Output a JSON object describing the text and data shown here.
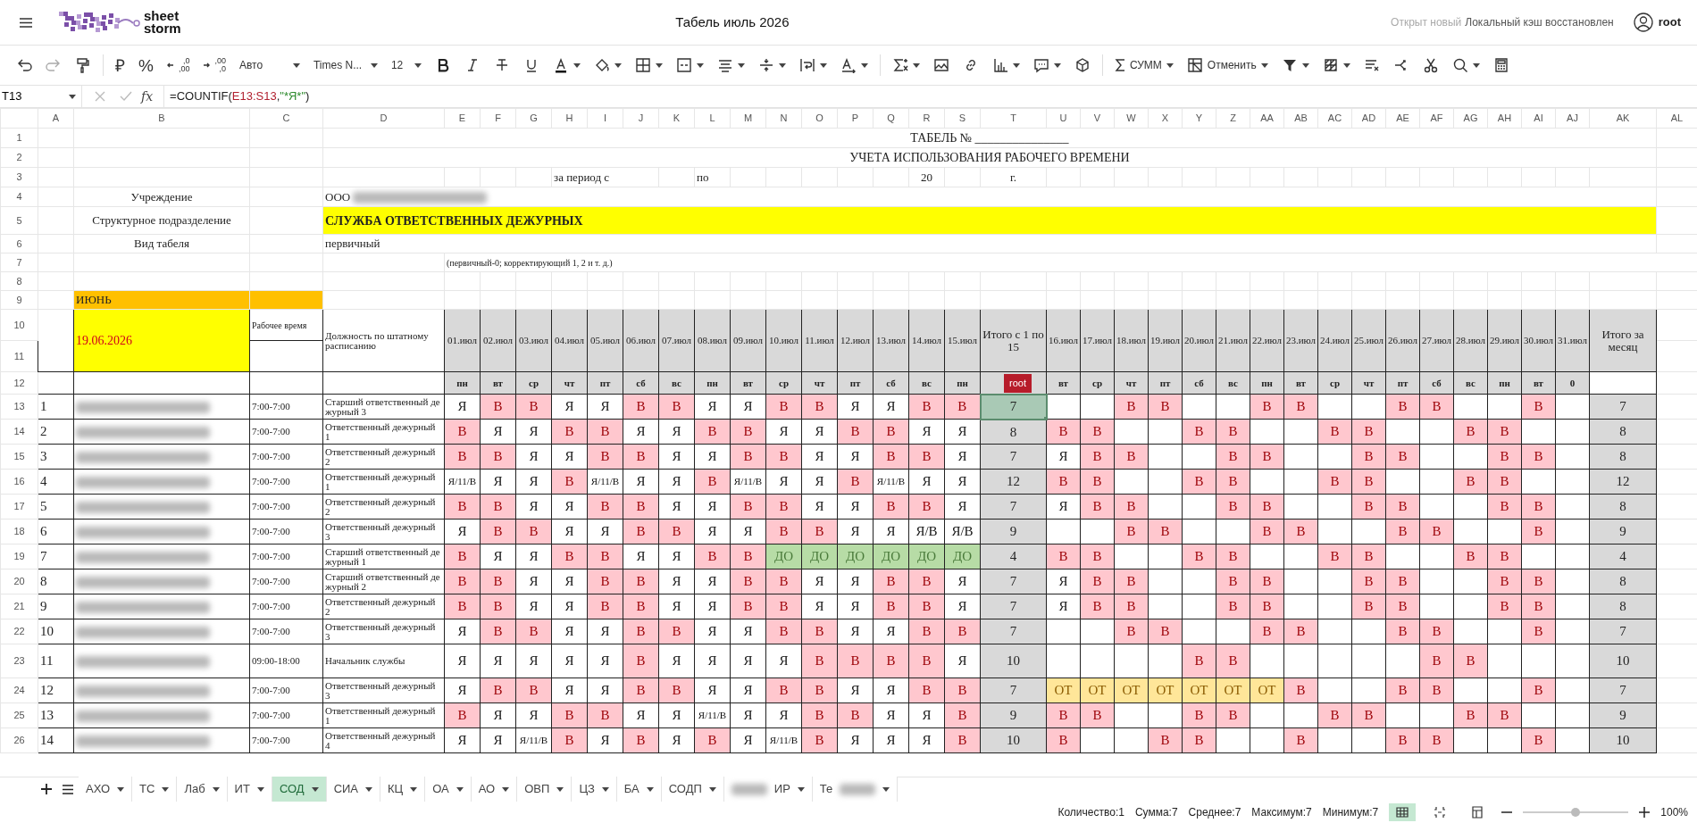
{
  "app_bar": {
    "logo_lines": [
      "sheet",
      "storm"
    ],
    "title": "Табель июль 2026",
    "sync_note": "Открыт новый",
    "sync_status": "Локальный кэш восстановлен",
    "user": "root"
  },
  "toolbar": {
    "currency": "₽",
    "percent": "%",
    "decimals_more": [
      ",0",
      ",00"
    ],
    "decimals_less": [
      ",00",
      ",0"
    ],
    "number_format": "Авто",
    "font_family": "Times N...",
    "font_size": "12",
    "autosum": "СУММ",
    "freeze": "Отменить"
  },
  "formula_bar": {
    "cell_ref": "T13",
    "fx": "fx",
    "formula": [
      {
        "text": "=COUNTIF(",
        "kind": "plain"
      },
      {
        "text": "E13:S13",
        "kind": "range"
      },
      {
        "text": ",",
        "kind": "plain"
      },
      {
        "text": "\"*Я*\"",
        "kind": "string"
      },
      {
        "text": ")",
        "kind": "plain"
      }
    ]
  },
  "columns": [
    "A",
    "B",
    "C",
    "D",
    "E",
    "F",
    "G",
    "H",
    "I",
    "J",
    "K",
    "L",
    "M",
    "N",
    "O",
    "P",
    "Q",
    "R",
    "S",
    "T",
    "U",
    "V",
    "W",
    "X",
    "Y",
    "Z",
    "AA",
    "AB",
    "AC",
    "AD",
    "AE",
    "AF",
    "AG",
    "AH",
    "AI",
    "AJ",
    "AK",
    "AL"
  ],
  "row_numbers": [
    "1",
    "2",
    "3",
    "4",
    "5",
    "6",
    "7",
    "8",
    "9",
    "10",
    "11",
    "12",
    "13",
    "14",
    "15",
    "16",
    "17",
    "18",
    "19",
    "20",
    "21",
    "22",
    "23",
    "24",
    "25",
    "26"
  ],
  "sheet": {
    "title_no": "ТАБЕЛЬ № _______________",
    "title": "УЧЕТА ИСПОЛЬЗОВАНИЯ РАБОЧЕГО ВРЕМЕНИ",
    "period_from": "за период с",
    "period_to": "по",
    "year_prefix": "20",
    "year_suffix": "г.",
    "org_label": "Учреждение",
    "org_value": "ООО",
    "dept_label": "Структурное подразделение",
    "dept_value": "СЛУЖБА ОТВЕТСТВЕННЫХ ДЕЖУРНЫХ",
    "type_label": "Вид табеля",
    "type_value": "первичный",
    "type_hint": "(первичный-0; корректирующий 1, 2 и т. д.)",
    "month": "ИЮНЬ",
    "date": "19.06.2026",
    "work_time_header": "Рабочее время",
    "position_header": "Должность по штатному расписанию",
    "half_total_header": "Итого с 1 по 15",
    "month_total_header": "Итого за месяц",
    "cursor_tag": "root",
    "day_headers": [
      "01.июл",
      "02.июл",
      "03.июл",
      "04.июл",
      "05.июл",
      "06.июл",
      "07.июл",
      "08.июл",
      "09.июл",
      "10.июл",
      "11.июл",
      "12.июл",
      "13.июл",
      "14.июл",
      "15.июл",
      "16.июл",
      "17.июл",
      "18.июл",
      "19.июл",
      "20.июл",
      "21.июл",
      "22.июл",
      "23.июл",
      "24.июл",
      "25.июл",
      "26.июл",
      "27.июл",
      "28.июл",
      "29.июл",
      "30.июл",
      "31.июл"
    ],
    "weekdays": [
      "пн",
      "вт",
      "ср",
      "чт",
      "пт",
      "сб",
      "вс",
      "пн",
      "вт",
      "ср",
      "чт",
      "пт",
      "сб",
      "вс",
      "пн",
      "вт",
      "ср",
      "чт",
      "пт",
      "сб",
      "вс",
      "пн",
      "вт",
      "ср",
      "чт",
      "пт",
      "сб",
      "вс",
      "пн",
      "вт",
      "0"
    ]
  },
  "rows": [
    {
      "num": "1",
      "time": "7:00-7:00",
      "position": "Старший ответственный дежурный 3",
      "total_half": "7",
      "total_selected": true,
      "total": "7",
      "days": [
        {
          "text": "Я",
          "kind": "work"
        },
        {
          "text": "В",
          "kind": "rest"
        },
        {
          "text": "В",
          "kind": "rest"
        },
        {
          "text": "Я",
          "kind": "work"
        },
        {
          "text": "Я",
          "kind": "work"
        },
        {
          "text": "В",
          "kind": "rest"
        },
        {
          "text": "В",
          "kind": "rest"
        },
        {
          "text": "Я",
          "kind": "work"
        },
        {
          "text": "Я",
          "kind": "work"
        },
        {
          "text": "В",
          "kind": "rest"
        },
        {
          "text": "В",
          "kind": "rest"
        },
        {
          "text": "Я",
          "kind": "work"
        },
        {
          "text": "Я",
          "kind": "work"
        },
        {
          "text": "В",
          "kind": "rest"
        },
        {
          "text": "В",
          "kind": "rest"
        },
        {
          "kind": "work"
        },
        {
          "kind": "work"
        },
        {
          "text": "В",
          "kind": "rest"
        },
        {
          "text": "В",
          "kind": "rest"
        },
        {
          "kind": "work"
        },
        {
          "kind": "work"
        },
        {
          "text": "В",
          "kind": "rest"
        },
        {
          "text": "В",
          "kind": "rest"
        },
        {
          "kind": "work"
        },
        {
          "kind": "work"
        },
        {
          "text": "В",
          "kind": "rest"
        },
        {
          "text": "В",
          "kind": "rest"
        },
        {
          "kind": "work"
        },
        {
          "kind": "work"
        },
        {
          "text": "В",
          "kind": "rest"
        },
        {
          "kind": "work"
        }
      ]
    },
    {
      "num": "2",
      "time": "7:00-7:00",
      "position": "Ответственный дежурный 1",
      "total_half": "8",
      "total_selected": false,
      "total": "8",
      "days": [
        {
          "text": "В",
          "kind": "rest"
        },
        {
          "text": "Я",
          "kind": "work"
        },
        {
          "text": "Я",
          "kind": "work"
        },
        {
          "text": "В",
          "kind": "rest"
        },
        {
          "text": "В",
          "kind": "rest"
        },
        {
          "text": "Я",
          "kind": "work"
        },
        {
          "text": "Я",
          "kind": "work"
        },
        {
          "text": "В",
          "kind": "rest"
        },
        {
          "text": "В",
          "kind": "rest"
        },
        {
          "text": "Я",
          "kind": "work"
        },
        {
          "text": "Я",
          "kind": "work"
        },
        {
          "text": "В",
          "kind": "rest"
        },
        {
          "text": "В",
          "kind": "rest"
        },
        {
          "text": "Я",
          "kind": "work"
        },
        {
          "text": "Я",
          "kind": "work"
        },
        {
          "text": "В",
          "kind": "rest"
        },
        {
          "text": "В",
          "kind": "rest"
        },
        {
          "kind": "work"
        },
        {
          "kind": "work"
        },
        {
          "text": "В",
          "kind": "rest"
        },
        {
          "text": "В",
          "kind": "rest"
        },
        {
          "kind": "work"
        },
        {
          "kind": "work"
        },
        {
          "text": "В",
          "kind": "rest"
        },
        {
          "text": "В",
          "kind": "rest"
        },
        {
          "kind": "work"
        },
        {
          "kind": "work"
        },
        {
          "text": "В",
          "kind": "rest"
        },
        {
          "text": "В",
          "kind": "rest"
        },
        {
          "kind": "work"
        },
        {
          "kind": "work"
        }
      ]
    },
    {
      "num": "3",
      "time": "7:00-7:00",
      "position": "Ответственный дежурный 2",
      "total_half": "7",
      "total_selected": false,
      "total": "8",
      "days": [
        {
          "text": "В",
          "kind": "rest"
        },
        {
          "text": "В",
          "kind": "rest"
        },
        {
          "text": "Я",
          "kind": "work"
        },
        {
          "text": "Я",
          "kind": "work"
        },
        {
          "text": "В",
          "kind": "rest"
        },
        {
          "text": "В",
          "kind": "rest"
        },
        {
          "text": "Я",
          "kind": "work"
        },
        {
          "text": "Я",
          "kind": "work"
        },
        {
          "text": "В",
          "kind": "rest"
        },
        {
          "text": "В",
          "kind": "rest"
        },
        {
          "text": "Я",
          "kind": "work"
        },
        {
          "text": "Я",
          "kind": "work"
        },
        {
          "text": "В",
          "kind": "rest"
        },
        {
          "text": "В",
          "kind": "rest"
        },
        {
          "text": "Я",
          "kind": "work"
        },
        {
          "text": "Я",
          "kind": "work"
        },
        {
          "text": "В",
          "kind": "rest"
        },
        {
          "text": "В",
          "kind": "rest"
        },
        {
          "kind": "work"
        },
        {
          "kind": "work"
        },
        {
          "text": "В",
          "kind": "rest"
        },
        {
          "text": "В",
          "kind": "rest"
        },
        {
          "kind": "work"
        },
        {
          "kind": "work"
        },
        {
          "text": "В",
          "kind": "rest"
        },
        {
          "text": "В",
          "kind": "rest"
        },
        {
          "kind": "work"
        },
        {
          "kind": "work"
        },
        {
          "text": "В",
          "kind": "rest"
        },
        {
          "text": "В",
          "kind": "rest"
        },
        {
          "kind": "work"
        }
      ]
    },
    {
      "num": "4",
      "time": "7:00-7:00",
      "position": "Ответственный дежурный 1",
      "total_half": "12",
      "total_selected": false,
      "total": "12",
      "days": [
        {
          "text": "Я/11/В",
          "kind": "work"
        },
        {
          "text": "Я",
          "kind": "work"
        },
        {
          "text": "Я",
          "kind": "work"
        },
        {
          "text": "В",
          "kind": "rest"
        },
        {
          "text": "Я/11/В",
          "kind": "work"
        },
        {
          "text": "Я",
          "kind": "work"
        },
        {
          "text": "Я",
          "kind": "work"
        },
        {
          "text": "В",
          "kind": "rest"
        },
        {
          "text": "Я/11/В",
          "kind": "work"
        },
        {
          "text": "Я",
          "kind": "work"
        },
        {
          "text": "Я",
          "kind": "work"
        },
        {
          "text": "В",
          "kind": "rest"
        },
        {
          "text": "Я/11/В",
          "kind": "work"
        },
        {
          "text": "Я",
          "kind": "work"
        },
        {
          "text": "Я",
          "kind": "work"
        },
        {
          "text": "В",
          "kind": "rest"
        },
        {
          "text": "В",
          "kind": "rest"
        },
        {
          "kind": "work"
        },
        {
          "kind": "work"
        },
        {
          "text": "В",
          "kind": "rest"
        },
        {
          "text": "В",
          "kind": "rest"
        },
        {
          "kind": "work"
        },
        {
          "kind": "work"
        },
        {
          "text": "В",
          "kind": "rest"
        },
        {
          "text": "В",
          "kind": "rest"
        },
        {
          "kind": "work"
        },
        {
          "kind": "work"
        },
        {
          "text": "В",
          "kind": "rest"
        },
        {
          "text": "В",
          "kind": "rest"
        },
        {
          "kind": "work"
        },
        {
          "kind": "work"
        }
      ]
    },
    {
      "num": "5",
      "time": "7:00-7:00",
      "position": "Ответственный дежурный 2",
      "total_half": "7",
      "total_selected": false,
      "total": "8",
      "days": [
        {
          "text": "В",
          "kind": "rest"
        },
        {
          "text": "В",
          "kind": "rest"
        },
        {
          "text": "Я",
          "kind": "work"
        },
        {
          "text": "Я",
          "kind": "work"
        },
        {
          "text": "В",
          "kind": "rest"
        },
        {
          "text": "В",
          "kind": "rest"
        },
        {
          "text": "Я",
          "kind": "work"
        },
        {
          "text": "Я",
          "kind": "work"
        },
        {
          "text": "В",
          "kind": "rest"
        },
        {
          "text": "В",
          "kind": "rest"
        },
        {
          "text": "Я",
          "kind": "work"
        },
        {
          "text": "Я",
          "kind": "work"
        },
        {
          "text": "В",
          "kind": "rest"
        },
        {
          "text": "В",
          "kind": "rest"
        },
        {
          "text": "Я",
          "kind": "work"
        },
        {
          "text": "Я",
          "kind": "work"
        },
        {
          "text": "В",
          "kind": "rest"
        },
        {
          "text": "В",
          "kind": "rest"
        },
        {
          "kind": "work"
        },
        {
          "kind": "work"
        },
        {
          "text": "В",
          "kind": "rest"
        },
        {
          "text": "В",
          "kind": "rest"
        },
        {
          "kind": "work"
        },
        {
          "kind": "work"
        },
        {
          "text": "В",
          "kind": "rest"
        },
        {
          "text": "В",
          "kind": "rest"
        },
        {
          "kind": "work"
        },
        {
          "kind": "work"
        },
        {
          "text": "В",
          "kind": "rest"
        },
        {
          "text": "В",
          "kind": "rest"
        },
        {
          "kind": "work"
        }
      ]
    },
    {
      "num": "6",
      "time": "7:00-7:00",
      "position": "Ответственный дежурный 3",
      "total_half": "9",
      "total_selected": false,
      "total": "9",
      "days": [
        {
          "text": "Я",
          "kind": "work"
        },
        {
          "text": "В",
          "kind": "rest"
        },
        {
          "text": "В",
          "kind": "rest"
        },
        {
          "text": "Я",
          "kind": "work"
        },
        {
          "text": "Я",
          "kind": "work"
        },
        {
          "text": "В",
          "kind": "rest"
        },
        {
          "text": "В",
          "kind": "rest"
        },
        {
          "text": "Я",
          "kind": "work"
        },
        {
          "text": "Я",
          "kind": "work"
        },
        {
          "text": "В",
          "kind": "rest"
        },
        {
          "text": "В",
          "kind": "rest"
        },
        {
          "text": "Я",
          "kind": "work"
        },
        {
          "text": "Я",
          "kind": "work"
        },
        {
          "text": "Я/В",
          "kind": "work"
        },
        {
          "text": "Я/В",
          "kind": "work"
        },
        {
          "kind": "work"
        },
        {
          "kind": "work"
        },
        {
          "text": "В",
          "kind": "rest"
        },
        {
          "text": "В",
          "kind": "rest"
        },
        {
          "kind": "work"
        },
        {
          "kind": "work"
        },
        {
          "text": "В",
          "kind": "rest"
        },
        {
          "text": "В",
          "kind": "rest"
        },
        {
          "kind": "work"
        },
        {
          "kind": "work"
        },
        {
          "text": "В",
          "kind": "rest"
        },
        {
          "text": "В",
          "kind": "rest"
        },
        {
          "kind": "work"
        },
        {
          "kind": "work"
        },
        {
          "text": "В",
          "kind": "rest"
        },
        {
          "kind": "work"
        }
      ]
    },
    {
      "num": "7",
      "time": "7:00-7:00",
      "position": "Старший ответственный дежурный 1",
      "total_half": "4",
      "total_selected": false,
      "total": "4",
      "days": [
        {
          "text": "В",
          "kind": "rest"
        },
        {
          "text": "Я",
          "kind": "work"
        },
        {
          "text": "Я",
          "kind": "work"
        },
        {
          "text": "В",
          "kind": "rest"
        },
        {
          "text": "В",
          "kind": "rest"
        },
        {
          "text": "Я",
          "kind": "work"
        },
        {
          "text": "Я",
          "kind": "work"
        },
        {
          "text": "В",
          "kind": "rest"
        },
        {
          "text": "В",
          "kind": "rest"
        },
        {
          "text": "ДО",
          "kind": "study"
        },
        {
          "text": "ДО",
          "kind": "study"
        },
        {
          "text": "ДО",
          "kind": "study"
        },
        {
          "text": "ДО",
          "kind": "study"
        },
        {
          "text": "ДО",
          "kind": "study"
        },
        {
          "text": "ДО",
          "kind": "study"
        },
        {
          "text": "В",
          "kind": "rest"
        },
        {
          "text": "В",
          "kind": "rest"
        },
        {
          "kind": "work"
        },
        {
          "kind": "work"
        },
        {
          "text": "В",
          "kind": "rest"
        },
        {
          "text": "В",
          "kind": "rest"
        },
        {
          "kind": "work"
        },
        {
          "kind": "work"
        },
        {
          "text": "В",
          "kind": "rest"
        },
        {
          "text": "В",
          "kind": "rest"
        },
        {
          "kind": "work"
        },
        {
          "kind": "work"
        },
        {
          "text": "В",
          "kind": "rest"
        },
        {
          "text": "В",
          "kind": "rest"
        },
        {
          "kind": "work"
        },
        {
          "kind": "work"
        }
      ]
    },
    {
      "num": "8",
      "time": "7:00-7:00",
      "position": "Старший ответственный дежурный 2",
      "total_half": "7",
      "total_selected": false,
      "total": "8",
      "days": [
        {
          "text": "В",
          "kind": "rest"
        },
        {
          "text": "В",
          "kind": "rest"
        },
        {
          "text": "Я",
          "kind": "work"
        },
        {
          "text": "Я",
          "kind": "work"
        },
        {
          "text": "В",
          "kind": "rest"
        },
        {
          "text": "В",
          "kind": "rest"
        },
        {
          "text": "Я",
          "kind": "work"
        },
        {
          "text": "Я",
          "kind": "work"
        },
        {
          "text": "В",
          "kind": "rest"
        },
        {
          "text": "В",
          "kind": "rest"
        },
        {
          "text": "Я",
          "kind": "work"
        },
        {
          "text": "Я",
          "kind": "work"
        },
        {
          "text": "В",
          "kind": "rest"
        },
        {
          "text": "В",
          "kind": "rest"
        },
        {
          "text": "Я",
          "kind": "work"
        },
        {
          "text": "Я",
          "kind": "work"
        },
        {
          "text": "В",
          "kind": "rest"
        },
        {
          "text": "В",
          "kind": "rest"
        },
        {
          "kind": "work"
        },
        {
          "kind": "work"
        },
        {
          "text": "В",
          "kind": "rest"
        },
        {
          "text": "В",
          "kind": "rest"
        },
        {
          "kind": "work"
        },
        {
          "kind": "work"
        },
        {
          "text": "В",
          "kind": "rest"
        },
        {
          "text": "В",
          "kind": "rest"
        },
        {
          "kind": "work"
        },
        {
          "kind": "work"
        },
        {
          "text": "В",
          "kind": "rest"
        },
        {
          "text": "В",
          "kind": "rest"
        },
        {
          "kind": "work"
        }
      ]
    },
    {
      "num": "9",
      "time": "7:00-7:00",
      "position": "Ответственный дежурный 2",
      "total_half": "7",
      "total_selected": false,
      "total": "8",
      "days": [
        {
          "text": "В",
          "kind": "rest"
        },
        {
          "text": "В",
          "kind": "rest"
        },
        {
          "text": "Я",
          "kind": "work"
        },
        {
          "text": "Я",
          "kind": "work"
        },
        {
          "text": "В",
          "kind": "rest"
        },
        {
          "text": "В",
          "kind": "rest"
        },
        {
          "text": "Я",
          "kind": "work"
        },
        {
          "text": "Я",
          "kind": "work"
        },
        {
          "text": "В",
          "kind": "rest"
        },
        {
          "text": "В",
          "kind": "rest"
        },
        {
          "text": "Я",
          "kind": "work"
        },
        {
          "text": "Я",
          "kind": "work"
        },
        {
          "text": "В",
          "kind": "rest"
        },
        {
          "text": "В",
          "kind": "rest"
        },
        {
          "text": "Я",
          "kind": "work"
        },
        {
          "text": "Я",
          "kind": "work"
        },
        {
          "text": "В",
          "kind": "rest"
        },
        {
          "text": "В",
          "kind": "rest"
        },
        {
          "kind": "work"
        },
        {
          "kind": "work"
        },
        {
          "text": "В",
          "kind": "rest"
        },
        {
          "text": "В",
          "kind": "rest"
        },
        {
          "kind": "work"
        },
        {
          "kind": "work"
        },
        {
          "text": "В",
          "kind": "rest"
        },
        {
          "text": "В",
          "kind": "rest"
        },
        {
          "kind": "work"
        },
        {
          "kind": "work"
        },
        {
          "text": "В",
          "kind": "rest"
        },
        {
          "text": "В",
          "kind": "rest"
        },
        {
          "kind": "work"
        }
      ]
    },
    {
      "num": "10",
      "time": "7:00-7:00",
      "position": "Ответственный дежурный 3",
      "total_half": "7",
      "total_selected": false,
      "total": "7",
      "days": [
        {
          "text": "Я",
          "kind": "work"
        },
        {
          "text": "В",
          "kind": "rest"
        },
        {
          "text": "В",
          "kind": "rest"
        },
        {
          "text": "Я",
          "kind": "work"
        },
        {
          "text": "Я",
          "kind": "work"
        },
        {
          "text": "В",
          "kind": "rest"
        },
        {
          "text": "В",
          "kind": "rest"
        },
        {
          "text": "Я",
          "kind": "work"
        },
        {
          "text": "Я",
          "kind": "work"
        },
        {
          "text": "В",
          "kind": "rest"
        },
        {
          "text": "В",
          "kind": "rest"
        },
        {
          "text": "Я",
          "kind": "work"
        },
        {
          "text": "Я",
          "kind": "work"
        },
        {
          "text": "В",
          "kind": "rest"
        },
        {
          "text": "В",
          "kind": "rest"
        },
        {
          "kind": "work"
        },
        {
          "kind": "work"
        },
        {
          "text": "В",
          "kind": "rest"
        },
        {
          "text": "В",
          "kind": "rest"
        },
        {
          "kind": "work"
        },
        {
          "kind": "work"
        },
        {
          "text": "В",
          "kind": "rest"
        },
        {
          "text": "В",
          "kind": "rest"
        },
        {
          "kind": "work"
        },
        {
          "kind": "work"
        },
        {
          "text": "В",
          "kind": "rest"
        },
        {
          "text": "В",
          "kind": "rest"
        },
        {
          "kind": "work"
        },
        {
          "kind": "work"
        },
        {
          "text": "В",
          "kind": "rest"
        },
        {
          "kind": "work"
        }
      ]
    },
    {
      "num": "11",
      "time": "09:00-18:00",
      "position": "Начальник службы",
      "total_half": "10",
      "total_selected": false,
      "total": "10",
      "days": [
        {
          "text": "Я",
          "kind": "work"
        },
        {
          "text": "Я",
          "kind": "work"
        },
        {
          "text": "Я",
          "kind": "work"
        },
        {
          "text": "Я",
          "kind": "work"
        },
        {
          "text": "Я",
          "kind": "work"
        },
        {
          "text": "В",
          "kind": "rest"
        },
        {
          "text": "Я",
          "kind": "work"
        },
        {
          "text": "Я",
          "kind": "work"
        },
        {
          "text": "Я",
          "kind": "work"
        },
        {
          "text": "Я",
          "kind": "work"
        },
        {
          "text": "В",
          "kind": "rest"
        },
        {
          "text": "В",
          "kind": "rest"
        },
        {
          "text": "В",
          "kind": "rest"
        },
        {
          "text": "В",
          "kind": "rest"
        },
        {
          "text": "Я",
          "kind": "work"
        },
        {
          "kind": "work"
        },
        {
          "kind": "work"
        },
        {
          "kind": "work"
        },
        {
          "kind": "work"
        },
        {
          "text": "В",
          "kind": "rest"
        },
        {
          "text": "В",
          "kind": "rest"
        },
        {
          "kind": "work"
        },
        {
          "kind": "work"
        },
        {
          "kind": "work"
        },
        {
          "kind": "work"
        },
        {
          "kind": "work"
        },
        {
          "text": "В",
          "kind": "rest"
        },
        {
          "text": "В",
          "kind": "rest"
        },
        {
          "kind": "work"
        },
        {
          "kind": "work"
        },
        {
          "kind": "work"
        }
      ]
    },
    {
      "num": "12",
      "time": "7:00-7:00",
      "position": "Ответственный дежурный 3",
      "total_half": "7",
      "total_selected": false,
      "total": "7",
      "days": [
        {
          "text": "Я",
          "kind": "work"
        },
        {
          "text": "В",
          "kind": "rest"
        },
        {
          "text": "В",
          "kind": "rest"
        },
        {
          "text": "Я",
          "kind": "work"
        },
        {
          "text": "Я",
          "kind": "work"
        },
        {
          "text": "В",
          "kind": "rest"
        },
        {
          "text": "В",
          "kind": "rest"
        },
        {
          "text": "Я",
          "kind": "work"
        },
        {
          "text": "Я",
          "kind": "work"
        },
        {
          "text": "В",
          "kind": "rest"
        },
        {
          "text": "В",
          "kind": "rest"
        },
        {
          "text": "Я",
          "kind": "work"
        },
        {
          "text": "Я",
          "kind": "work"
        },
        {
          "text": "В",
          "kind": "rest"
        },
        {
          "text": "В",
          "kind": "rest"
        },
        {
          "text": "ОТ",
          "kind": "leave"
        },
        {
          "text": "ОТ",
          "kind": "leave"
        },
        {
          "text": "ОТ",
          "kind": "leave"
        },
        {
          "text": "ОТ",
          "kind": "leave"
        },
        {
          "text": "ОТ",
          "kind": "leave"
        },
        {
          "text": "ОТ",
          "kind": "leave"
        },
        {
          "text": "ОТ",
          "kind": "leave"
        },
        {
          "text": "В",
          "kind": "rest"
        },
        {
          "kind": "work"
        },
        {
          "kind": "work"
        },
        {
          "text": "В",
          "kind": "rest"
        },
        {
          "text": "В",
          "kind": "rest"
        },
        {
          "kind": "work"
        },
        {
          "kind": "work"
        },
        {
          "text": "В",
          "kind": "rest"
        },
        {
          "kind": "work"
        }
      ]
    },
    {
      "num": "13",
      "time": "7:00-7:00",
      "position": "Ответственный дежурный 1",
      "total_half": "9",
      "total_selected": false,
      "total": "9",
      "days": [
        {
          "text": "В",
          "kind": "rest"
        },
        {
          "text": "Я",
          "kind": "work"
        },
        {
          "text": "Я",
          "kind": "work"
        },
        {
          "text": "В",
          "kind": "rest"
        },
        {
          "text": "В",
          "kind": "rest"
        },
        {
          "text": "Я",
          "kind": "work"
        },
        {
          "text": "Я",
          "kind": "work"
        },
        {
          "text": "Я/11/В",
          "kind": "work"
        },
        {
          "text": "Я",
          "kind": "work"
        },
        {
          "text": "Я",
          "kind": "work"
        },
        {
          "text": "В",
          "kind": "rest"
        },
        {
          "text": "В",
          "kind": "rest"
        },
        {
          "text": "Я",
          "kind": "work"
        },
        {
          "text": "Я",
          "kind": "work"
        },
        {
          "text": "В",
          "kind": "rest"
        },
        {
          "text": "В",
          "kind": "rest"
        },
        {
          "text": "В",
          "kind": "rest"
        },
        {
          "kind": "work"
        },
        {
          "kind": "work"
        },
        {
          "text": "В",
          "kind": "rest"
        },
        {
          "text": "В",
          "kind": "rest"
        },
        {
          "kind": "work"
        },
        {
          "kind": "work"
        },
        {
          "text": "В",
          "kind": "rest"
        },
        {
          "text": "В",
          "kind": "rest"
        },
        {
          "kind": "work"
        },
        {
          "kind": "work"
        },
        {
          "text": "В",
          "kind": "rest"
        },
        {
          "text": "В",
          "kind": "rest"
        },
        {
          "kind": "work"
        },
        {
          "kind": "work"
        }
      ]
    },
    {
      "num": "14",
      "time": "7:00-7:00",
      "position": "Ответственный дежурный 4",
      "total_half": "10",
      "total_selected": false,
      "total": "10",
      "days": [
        {
          "text": "Я",
          "kind": "work"
        },
        {
          "text": "Я",
          "kind": "work"
        },
        {
          "text": "Я/11/В",
          "kind": "work"
        },
        {
          "text": "В",
          "kind": "rest"
        },
        {
          "text": "Я",
          "kind": "work"
        },
        {
          "text": "В",
          "kind": "rest"
        },
        {
          "text": "Я",
          "kind": "work"
        },
        {
          "text": "В",
          "kind": "rest"
        },
        {
          "text": "Я",
          "kind": "work"
        },
        {
          "text": "Я/11/В",
          "kind": "work"
        },
        {
          "text": "В",
          "kind": "rest"
        },
        {
          "text": "Я",
          "kind": "work"
        },
        {
          "text": "Я",
          "kind": "work"
        },
        {
          "text": "Я",
          "kind": "work"
        },
        {
          "text": "В",
          "kind": "rest"
        },
        {
          "text": "В",
          "kind": "rest"
        },
        {
          "kind": "work"
        },
        {
          "kind": "work"
        },
        {
          "text": "В",
          "kind": "rest"
        },
        {
          "text": "В",
          "kind": "rest"
        },
        {
          "kind": "work"
        },
        {
          "kind": "work"
        },
        {
          "text": "В",
          "kind": "rest"
        },
        {
          "kind": "work"
        },
        {
          "kind": "work"
        },
        {
          "text": "В",
          "kind": "rest"
        },
        {
          "text": "В",
          "kind": "rest"
        },
        {
          "kind": "work"
        },
        {
          "kind": "work"
        },
        {
          "text": "В",
          "kind": "rest"
        },
        {
          "kind": "work"
        }
      ]
    }
  ],
  "sheet_tabs": [
    {
      "label": "АХО",
      "selected": false
    },
    {
      "label": "ТС",
      "selected": false
    },
    {
      "label": "Лаб",
      "selected": false
    },
    {
      "label": "ИТ",
      "selected": false
    },
    {
      "label": "СОД",
      "selected": true
    },
    {
      "label": "СИА",
      "selected": false
    },
    {
      "label": "КЦ",
      "selected": false
    },
    {
      "label": "ОА",
      "selected": false
    },
    {
      "label": "АО",
      "selected": false
    },
    {
      "label": "ОВП",
      "selected": false
    },
    {
      "label": "ЦЗ",
      "selected": false
    },
    {
      "label": "БА",
      "selected": false
    },
    {
      "label": "СОДП",
      "selected": false
    },
    {
      "label": "ИР",
      "selected": false,
      "kind": "redacted_before"
    },
    {
      "label": "Те",
      "selected": false,
      "kind": "redacted_after"
    }
  ],
  "status_bar": {
    "stats": [
      "Количество:1",
      "Сумма:7",
      "Среднее:7",
      "Максимум:7",
      "Минимум:7"
    ],
    "view_modes": [
      {
        "selected": true
      },
      {
        "selected": false
      },
      {
        "selected": false
      }
    ],
    "zoom_slider": {
      "level": 0.5
    },
    "zoom": "100%"
  }
}
